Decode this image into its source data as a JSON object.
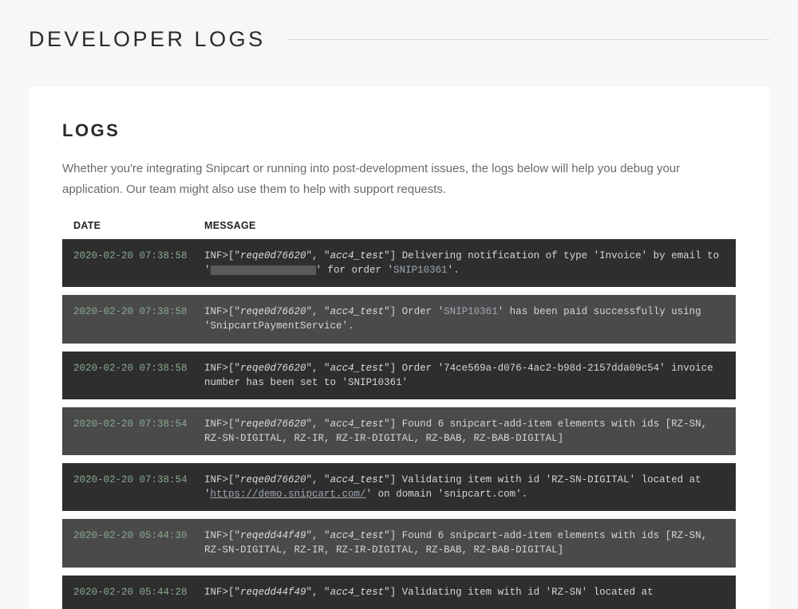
{
  "page_title": "DEVELOPER LOGS",
  "panel": {
    "title": "LOGS",
    "description": "Whether you're integrating Snipcart or running into post-development issues, the logs below will help you debug your application. Our team might also use them to help with support requests."
  },
  "table": {
    "headers": {
      "date": "DATE",
      "message": "MESSAGE"
    }
  },
  "logs": [
    {
      "shade": "dark",
      "timestamp": "2020-02-20 07:38:58",
      "level": "INF",
      "req": "reqe0d76620",
      "acc": "acc4_test",
      "segments": [
        {
          "kind": "text",
          "text": " Delivering notification of type 'Invoice' by email to '"
        },
        {
          "kind": "redact"
        },
        {
          "kind": "text",
          "text": "' for order '"
        },
        {
          "kind": "hilite",
          "text": "SNIP10361"
        },
        {
          "kind": "text",
          "text": "'."
        }
      ]
    },
    {
      "shade": "light",
      "timestamp": "2020-02-20 07:38:58",
      "level": "INF",
      "req": "reqe0d76620",
      "acc": "acc4_test",
      "segments": [
        {
          "kind": "text",
          "text": " Order '"
        },
        {
          "kind": "hilite",
          "text": "SNIP10361"
        },
        {
          "kind": "text",
          "text": "' has been paid successfully using 'SnipcartPaymentService'."
        }
      ]
    },
    {
      "shade": "dark",
      "timestamp": "2020-02-20 07:38:58",
      "level": "INF",
      "req": "reqe0d76620",
      "acc": "acc4_test",
      "segments": [
        {
          "kind": "text",
          "text": " Order '74ce569a-d076-4ac2-b98d-2157dda09c54' invoice number has been set to 'SNIP10361'"
        }
      ]
    },
    {
      "shade": "light",
      "timestamp": "2020-02-20 07:38:54",
      "level": "INF",
      "req": "reqe0d76620",
      "acc": "acc4_test",
      "segments": [
        {
          "kind": "text",
          "text": " Found 6 snipcart-add-item elements with ids [RZ-SN, RZ-SN-DIGITAL, RZ-IR, RZ-IR-DIGITAL, RZ-BAB, RZ-BAB-DIGITAL]"
        }
      ]
    },
    {
      "shade": "dark",
      "timestamp": "2020-02-20 07:38:54",
      "level": "INF",
      "req": "reqe0d76620",
      "acc": "acc4_test",
      "segments": [
        {
          "kind": "text",
          "text": " Validating item with id 'RZ-SN-DIGITAL' located at '"
        },
        {
          "kind": "link",
          "text": "https://demo.snipcart.com/"
        },
        {
          "kind": "text",
          "text": "' on domain 'snipcart.com'."
        }
      ]
    },
    {
      "shade": "light",
      "timestamp": "2020-02-20 05:44:30",
      "level": "INF",
      "req": "reqedd44f49",
      "acc": "acc4_test",
      "segments": [
        {
          "kind": "text",
          "text": " Found 6 snipcart-add-item elements with ids [RZ-SN, RZ-SN-DIGITAL, RZ-IR, RZ-IR-DIGITAL, RZ-BAB, RZ-BAB-DIGITAL]"
        }
      ]
    },
    {
      "shade": "dark",
      "timestamp": "2020-02-20 05:44:28",
      "level": "INF",
      "req": "reqedd44f49",
      "acc": "acc4_test",
      "segments": [
        {
          "kind": "text",
          "text": " Validating item with id 'RZ-SN' located at "
        }
      ]
    }
  ]
}
